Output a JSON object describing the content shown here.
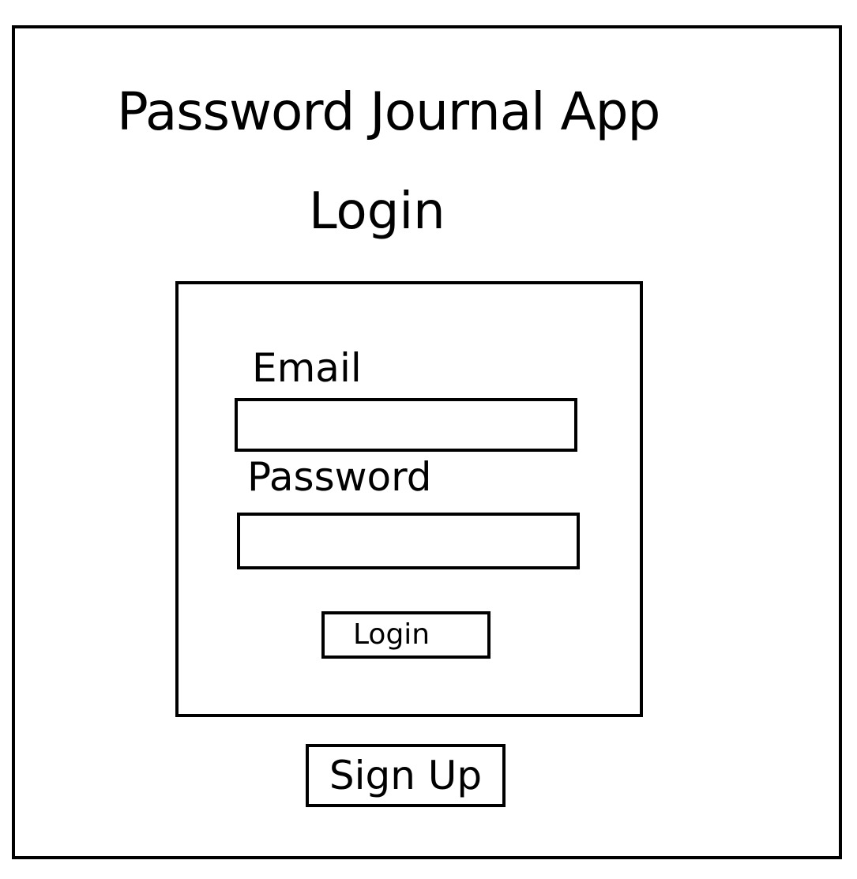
{
  "app": {
    "title": "Password Journal App"
  },
  "page": {
    "heading": "Login"
  },
  "form": {
    "email_label": "Email",
    "email_value": "",
    "password_label": "Password",
    "password_value": "",
    "login_label": "Login"
  },
  "signup": {
    "label": "Sign Up"
  },
  "colors": {
    "border": "#000000",
    "background": "#ffffff",
    "text": "#000000"
  }
}
